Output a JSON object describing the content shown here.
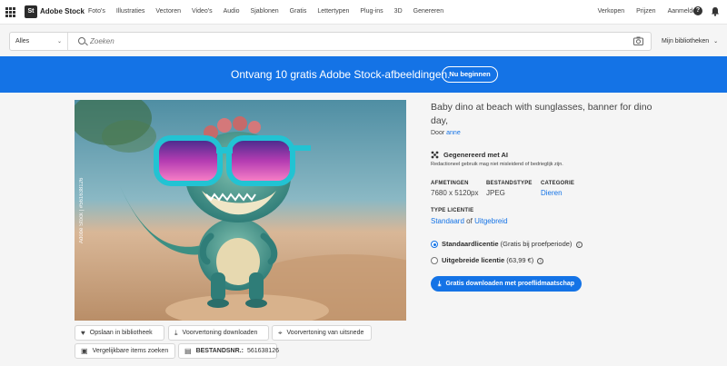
{
  "header": {
    "logo_text": "St",
    "brand": "Adobe Stock",
    "nav": [
      "Foto's",
      "Illustraties",
      "Vectoren",
      "Video's",
      "Audio",
      "Sjablonen",
      "Gratis",
      "Lettertypen",
      "Plug-ins",
      "3D",
      "Genereren"
    ],
    "right_nav": [
      "Verkopen",
      "Prijzen",
      "Aanmelden"
    ],
    "help_symbol": "?"
  },
  "search": {
    "filter_value": "Alles",
    "placeholder": "Zoeken",
    "libraries_label": "Mijn bibliotheken"
  },
  "banner": {
    "text": "Ontvang 10 gratis Adobe Stock-afbeeldingen.",
    "button": "Nu beginnen",
    "color": "#1473e6"
  },
  "asset": {
    "watermark": "Adobe Stock | #561638126",
    "actions": {
      "save": "Opslaan in bibliotheek",
      "download_preview": "Voorvertoning downloaden",
      "crop_preview": "Voorvertoning van uitsnede",
      "find_similar": "Vergelijkbare items zoeken",
      "file_no_label": "BESTANDSNR.:",
      "file_no": "561638126"
    },
    "title": "Baby dino at beach with sunglasses, banner for dino day,",
    "by_label": "Door",
    "author": "anne",
    "ai_title": "Gegenereerd met AI",
    "ai_note": "Redactioneel gebruik mag niet misleidend of bedrieglijk zijn.",
    "dimensions_label": "AFMETINGEN",
    "dimensions": "7680 x 5120px",
    "filetype_label": "BESTANDSTYPE",
    "filetype": "JPEG",
    "category_label": "CATEGORIE",
    "category": "Dieren",
    "license_type_label": "TYPE LICENTIE",
    "license_standard": "Standaard",
    "license_or": "of",
    "license_extended": "Uitgebreid",
    "options": [
      {
        "name": "Standaardlicentie",
        "note": "(Gratis bij proefperiode)",
        "selected": true
      },
      {
        "name": "Uitgebreide licentie",
        "note": "(63,99 €)",
        "selected": false
      }
    ],
    "cta": "Gratis downloaden met proeflidmaatschap",
    "accent": "#1473e6"
  }
}
